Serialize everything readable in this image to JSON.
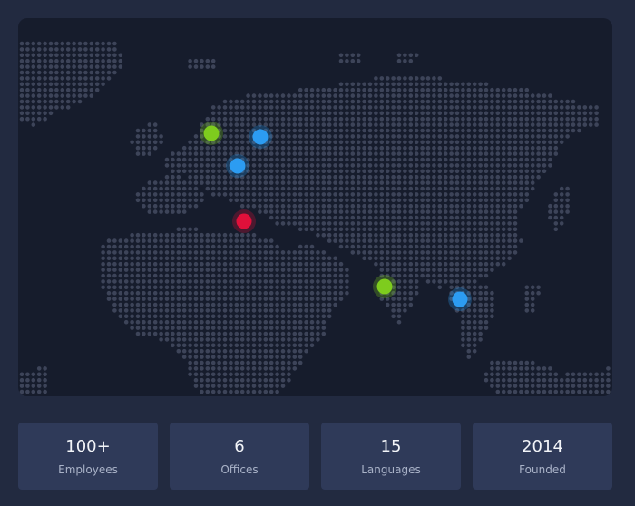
{
  "colors": {
    "page_background": "#222a40",
    "map_background": "#161c2c",
    "land_dot": "#3d4459",
    "card_background": "#2f3a59",
    "marker_green": "#7ecc1e",
    "marker_blue": "#2c9cf2",
    "marker_red": "#e0103a"
  },
  "map": {
    "markers": [
      {
        "id": "marker-green-west-europe",
        "color_key": "marker_green",
        "icon": "location-dot-icon"
      },
      {
        "id": "marker-blue-baltic",
        "color_key": "marker_blue",
        "icon": "location-dot-icon"
      },
      {
        "id": "marker-blue-central-europe",
        "color_key": "marker_blue",
        "icon": "location-dot-icon"
      },
      {
        "id": "marker-red-balkans",
        "color_key": "marker_red",
        "icon": "location-dot-icon"
      },
      {
        "id": "marker-green-india",
        "color_key": "marker_green",
        "icon": "location-dot-icon"
      },
      {
        "id": "marker-blue-southeast-asia",
        "color_key": "marker_blue",
        "icon": "location-dot-icon"
      }
    ]
  },
  "stats": [
    {
      "value": "100+",
      "label": "Employees"
    },
    {
      "value": "6",
      "label": "Offices"
    },
    {
      "value": "15",
      "label": "Languages"
    },
    {
      "value": "2014",
      "label": "Founded"
    }
  ]
}
